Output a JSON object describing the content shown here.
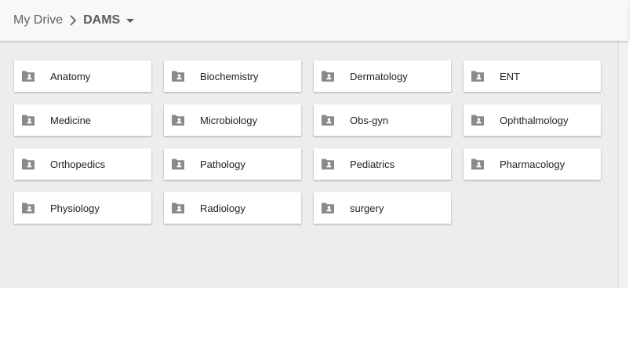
{
  "breadcrumb": {
    "root": "My Drive",
    "current": "DAMS"
  },
  "icons": {
    "separator": "chevron-right-icon",
    "dropdown": "caret-down-icon",
    "folder": "shared-folder-icon"
  },
  "colors": {
    "folder_icon": "#8a8a8a",
    "content_bg": "#ededed",
    "header_bg": "#f8f8f8"
  },
  "folders": [
    {
      "label": "Anatomy"
    },
    {
      "label": "Biochemistry"
    },
    {
      "label": "Dermatology"
    },
    {
      "label": "ENT"
    },
    {
      "label": "Medicine"
    },
    {
      "label": "Microbiology"
    },
    {
      "label": "Obs-gyn"
    },
    {
      "label": "Ophthalmology"
    },
    {
      "label": "Orthopedics"
    },
    {
      "label": "Pathology"
    },
    {
      "label": "Pediatrics"
    },
    {
      "label": "Pharmacology"
    },
    {
      "label": "Physiology"
    },
    {
      "label": "Radiology"
    },
    {
      "label": "surgery"
    }
  ]
}
